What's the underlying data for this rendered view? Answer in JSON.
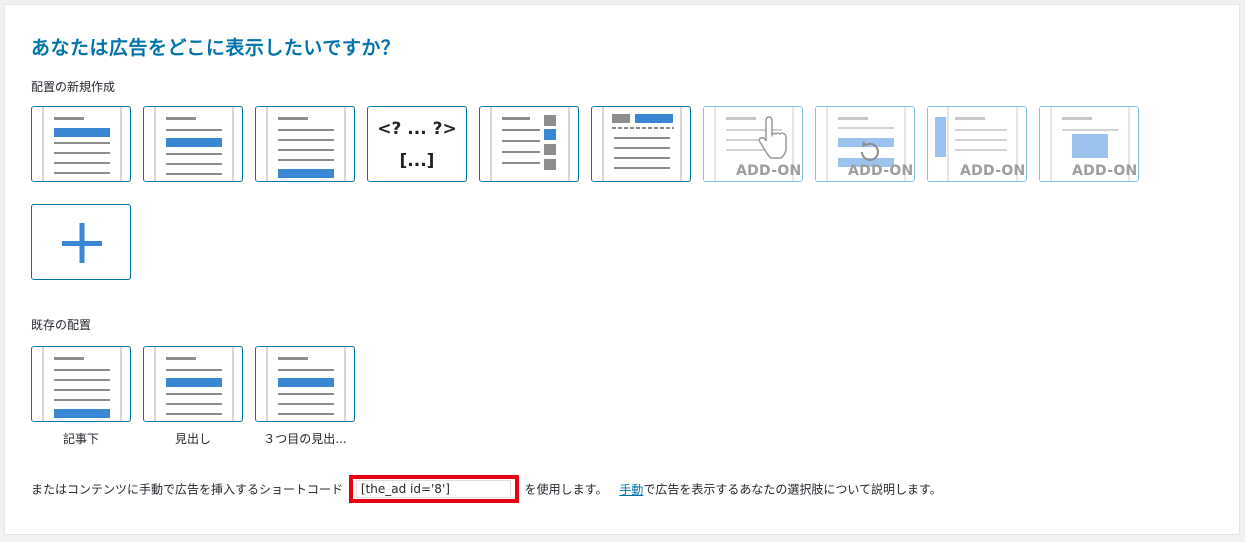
{
  "title": "あなたは広告をどこに表示したいですか？",
  "new_placement": {
    "label": "配置の新規作成",
    "code_tile": {
      "line1": "<? ... ?>",
      "line2": "[...]"
    },
    "addon_label": "ADD-ON"
  },
  "existing_placement": {
    "label": "既存の配置",
    "items": [
      {
        "caption": "記事下"
      },
      {
        "caption": "見出し"
      },
      {
        "caption": "３つ目の見出..."
      }
    ]
  },
  "shortcode": {
    "prefix": "またはコンテンツに手動で広告を挿入するショートコード",
    "value": "[the_ad id='8']",
    "suffix": "を使用します。",
    "link": "手動",
    "tail": "で広告を表示するあなたの選択肢について説明します。"
  },
  "colors": {
    "accent": "#0073aa",
    "blue_block": "#3a87d6",
    "highlight": "#e60012"
  }
}
